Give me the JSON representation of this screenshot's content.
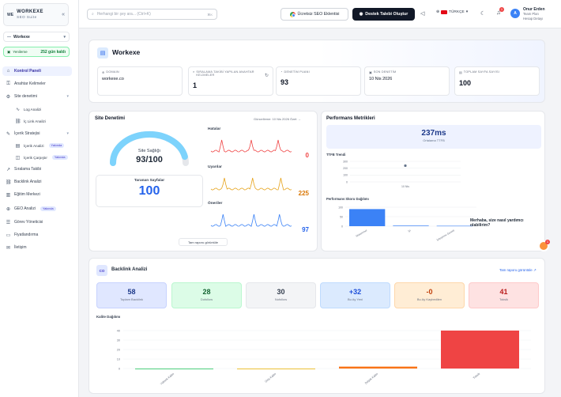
{
  "sidebar": {
    "logo_mark": "WE",
    "logo_name": "WORKEXE",
    "logo_sub": "SEO Suite",
    "workspace": "Workexe",
    "trial_label": "Yenileme",
    "trial_days": "252 gün kaldı",
    "items": [
      {
        "label": "Kontrol Paneli",
        "icon": "home-icon"
      },
      {
        "label": "Anahtar Kelimeler",
        "icon": "key-icon"
      },
      {
        "label": "Site denetimi",
        "icon": "gear-icon"
      },
      {
        "label": "Log Analizi",
        "icon": "wave-icon"
      },
      {
        "label": "İç Link Analizi",
        "icon": "link-icon"
      },
      {
        "label": "İçerik Stratejisi",
        "icon": "pen-icon"
      },
      {
        "label": "İçerik Analizi",
        "icon": "doc-icon",
        "badge": "Yakında"
      },
      {
        "label": "İçerik Çarpıştır",
        "icon": "layers-icon",
        "badge": "Yakında"
      },
      {
        "label": "Sıralama Takibi",
        "icon": "trend-icon"
      },
      {
        "label": "Backlink Analizi",
        "icon": "link-icon"
      },
      {
        "label": "Eğitim Merkezi",
        "icon": "book-icon"
      },
      {
        "label": "GEO Analizi",
        "icon": "globe-icon",
        "badge": "Yakında"
      },
      {
        "label": "Görev Yöneticisi",
        "icon": "list-icon"
      },
      {
        "label": "Fiyatlandırma",
        "icon": "card-icon"
      },
      {
        "label": "İletişim",
        "icon": "mail-icon"
      }
    ]
  },
  "topbar": {
    "search_placeholder": "Herhangi bir şey ara... (Ctrl+K)",
    "search_kbd": "⌘K",
    "extension_label": "Ücretsiz SEO Eklentisi",
    "support_label": "Destek Talebi Oluştur",
    "language": "TÜRKÇE",
    "notification_count": "1",
    "user_initial": "A",
    "user_name": "Onur Erden",
    "user_plan": "Team Plan",
    "user_link": "Hesap Detayı"
  },
  "project": {
    "name": "Workexe",
    "kpis": [
      {
        "label": "DOMAIN",
        "value": "workexe.co"
      },
      {
        "label": "SIRALAMA TAKİBİ YAPILAN ANAHTAR KELİMELER",
        "value": "1"
      },
      {
        "label": "DENETİM PUANI",
        "value": "93"
      },
      {
        "label": "SON DENETİM",
        "value": "10 Nis 2026"
      },
      {
        "label": "TOPLAM SAYFA SAYISI",
        "value": "100"
      }
    ]
  },
  "audit": {
    "title": "Site Denetimi",
    "last_audit": "Güncelleme: 10 Nis 2026 Özet →",
    "health_label": "Site Sağlığı",
    "health_value": "93/100",
    "health_score": 93,
    "pages_label": "Taranan Sayfalar",
    "pages_value": "100",
    "errors_label": "Hatalar",
    "errors_value": "0",
    "warnings_label": "Uyarılar",
    "warnings_value": "225",
    "notices_label": "Öneriler",
    "notices_value": "97",
    "report_button": "Tam raporu görüntüle",
    "colors": {
      "errors": "#ef4444",
      "warnings": "#e6a31b",
      "notices": "#3b82f6"
    }
  },
  "performance": {
    "title": "Performans Metrikleri",
    "ttfb_value": "237ms",
    "ttfb_label": "Ortalama TTFB",
    "ttfb_trend_title": "TTFB Trendi",
    "ttfb_ticks": [
      "300",
      "200",
      "100",
      "0"
    ],
    "ttfb_x": "10 Nis",
    "score_title": "Performans Skoru Dağılımı",
    "score_ticks": [
      "100",
      "50",
      "0"
    ],
    "score_categories": [
      "Mükemmel",
      "İyi",
      "İyileştirme Gerekli"
    ],
    "chat_text": "Merhaba, size nasıl yardımcı olabilirim?",
    "chat_badge": "1"
  },
  "backlink": {
    "title": "Backlink Analizi",
    "icon_text": "CO",
    "link": "Tam raporu görüntüle ↗",
    "stats": [
      {
        "value": "58",
        "label": "Toplam Backlink",
        "bg": "#e0e7ff",
        "border": "#c7d2fe",
        "color": "#1e3a8a"
      },
      {
        "value": "28",
        "label": "Dofollow",
        "bg": "#dcfce7",
        "border": "#bbf7d0",
        "color": "#166534"
      },
      {
        "value": "30",
        "label": "Nofollow",
        "bg": "#f3f4f6",
        "border": "#e5e7eb",
        "color": "#374151"
      },
      {
        "value": "+32",
        "label": "Bu Ay Yeni",
        "bg": "#dbeafe",
        "border": "#bfdbfe",
        "color": "#1d4ed8"
      },
      {
        "value": "-0",
        "label": "Bu Ay Kaybedilen",
        "bg": "#ffedd5",
        "border": "#fed7aa",
        "color": "#c2410c"
      },
      {
        "value": "41",
        "label": "Toksik",
        "bg": "#fee2e2",
        "border": "#fecaca",
        "color": "#b91c1c"
      }
    ],
    "quality_title": "Kalite Dağılımı"
  },
  "chart_data": [
    {
      "type": "line",
      "title": "TTFB Trendi",
      "x": [
        "10 Nis"
      ],
      "series": [
        {
          "values": [
            237
          ]
        }
      ],
      "ylim": [
        0,
        300
      ]
    },
    {
      "type": "bar",
      "title": "Performans Skoru Dağılımı",
      "categories": [
        "Mükemmel",
        "İyi",
        "İyileştirme Gerekli"
      ],
      "values": [
        90,
        3,
        2
      ],
      "ylim": [
        0,
        100
      ],
      "colors": [
        "#3b82f6",
        "#3b82f6",
        "#3b82f6"
      ]
    },
    {
      "type": "bar",
      "title": "Kalite Dağılımı",
      "categories": [
        "Yüksek Kalite",
        "Orta Kalite",
        "Düşük Kalite",
        "Toksik"
      ],
      "values": [
        0,
        0,
        2,
        41
      ],
      "ylim": [
        0,
        40
      ],
      "yticks": [
        "40",
        "30",
        "20",
        "10",
        "0"
      ],
      "colors": [
        "#22c55e",
        "#eab308",
        "#f97316",
        "#ef4444"
      ]
    }
  ]
}
